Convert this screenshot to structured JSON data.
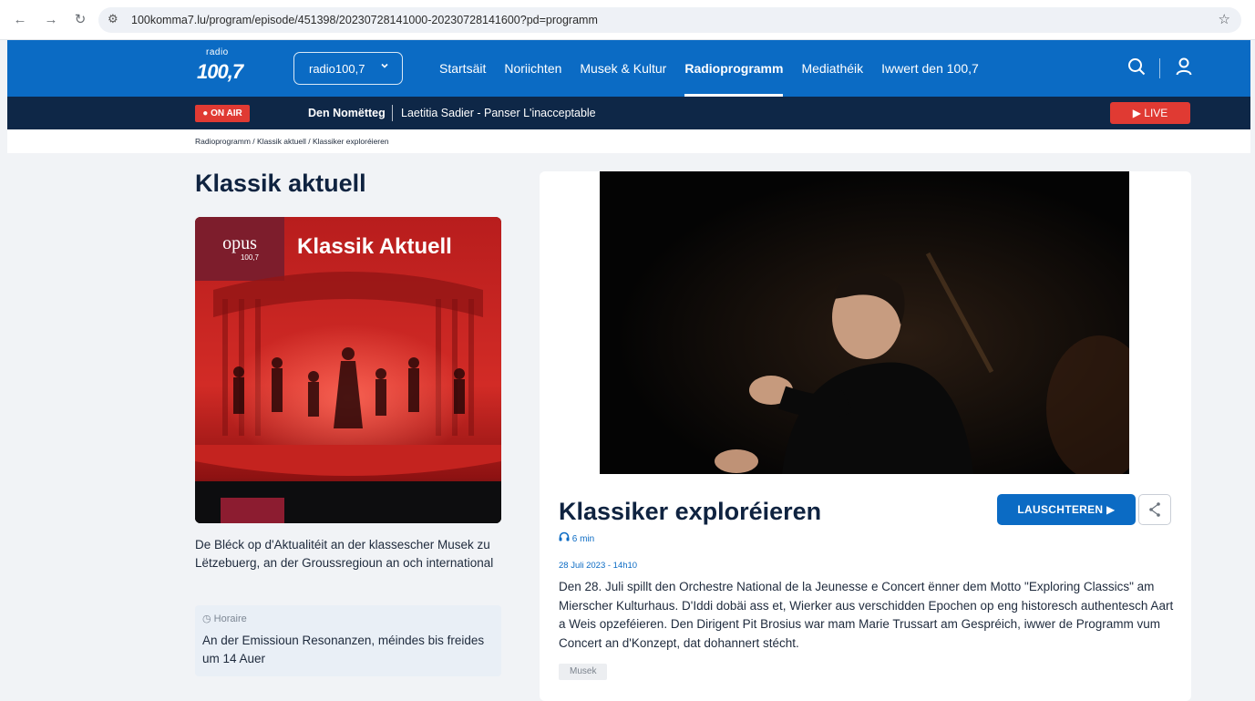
{
  "browser": {
    "url": "100komma7.lu/program/episode/451398/20230728141000-20230728141600?pd=programm"
  },
  "header": {
    "logo_small": "radio",
    "logo_big": "100,7",
    "station_select": "radio100,7",
    "nav": [
      "Startsäit",
      "Noriichten",
      "Musek & Kultur",
      "Radioprogramm",
      "Mediathéik",
      "Iwwert den 100,7"
    ],
    "active_nav": "Radioprogramm",
    "brand_color": "#0b6bc4"
  },
  "onair": {
    "badge": "ON AIR",
    "show": "Den Nomëtteg",
    "track": "Laetitia Sadier - Panser L'inacceptable",
    "live": "LIVE",
    "accent_color": "#e03a33"
  },
  "breadcrumb": "Radioprogramm / Klassik aktuell / Klassiker exploréieren",
  "program": {
    "title": "Klassik aktuell",
    "cover_brand": "opus",
    "cover_brand_sub": "100,7",
    "cover_title": "Klassik Aktuell",
    "description": "De Bléck op d'Aktualitéit an der klassescher Musek zu Lëtzebuerg, an der Groussregioun an och international",
    "horaire_label": "Horaire",
    "horaire_text": "An der Emissioun Resonanzen, méindes bis freides um 14 Auer"
  },
  "episode": {
    "title": "Klassiker exploréieren",
    "listen": "LAUSCHTEREN",
    "duration": "6 min",
    "date": "28 Juli 2023 - 14h10",
    "description": "Den 28. Juli spillt den Orchestre National de la Jeunesse e Concert ënner dem Motto \"Exploring Classics\" am Mierscher Kulturhaus. D'Iddi dobäi ass et, Wierker aus verschidden Epochen op eng historesch authentesch Aart a Weis opzeféieren. Den Dirigent Pit Brosius war mam Marie Trussart am Gespréich, iwwer de Programm vum Concert an d'Konzept, dat dohannert stécht.",
    "tag": "Musek"
  }
}
